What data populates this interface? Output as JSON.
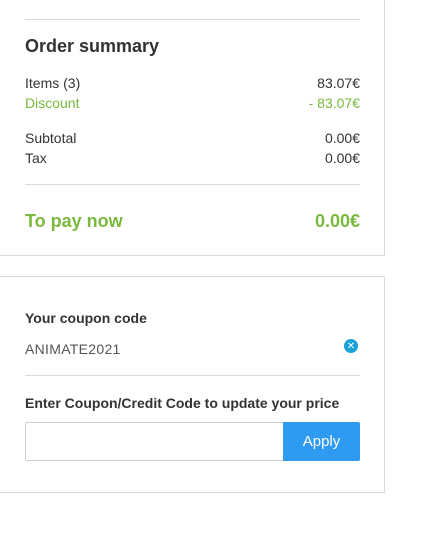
{
  "summary": {
    "title": "Order summary",
    "items_label": "Items (3)",
    "items_value": "83.07€",
    "discount_label": "Discount",
    "discount_value": "- 83.07€",
    "subtotal_label": "Subtotal",
    "subtotal_value": "0.00€",
    "tax_label": "Tax",
    "tax_value": "0.00€",
    "topay_label": "To pay now",
    "topay_value": "0.00€"
  },
  "coupon": {
    "heading": "Your coupon code",
    "applied_code": "ANIMATE2021",
    "remove_icon": "close-circle-icon",
    "entry_heading": "Enter Coupon/Credit Code to update your price",
    "input_value": "",
    "input_placeholder": "",
    "apply_label": "Apply"
  },
  "colors": {
    "accent_green": "#7ab93d",
    "button_blue": "#2e9af2",
    "icon_blue": "#1aa1d6"
  }
}
